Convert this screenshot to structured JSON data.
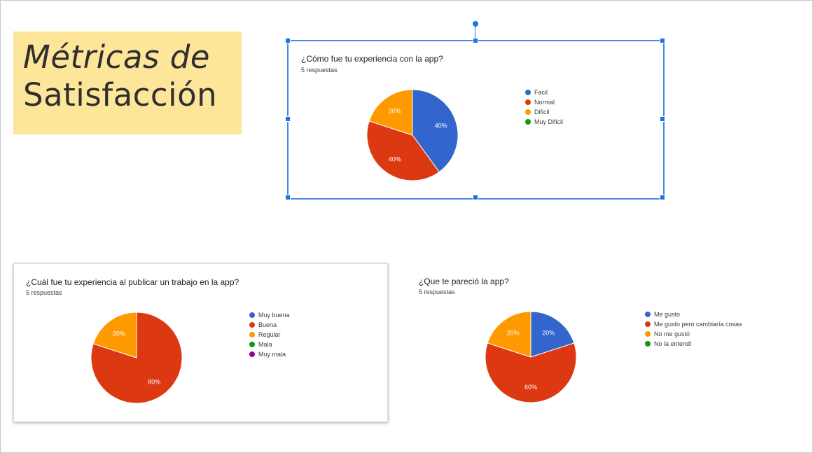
{
  "slide": {
    "title_line1": "Métricas de",
    "title_line2": "Satisfacción"
  },
  "colors": {
    "blue": "#3366cc",
    "red": "#dc3912",
    "orange": "#ff9900",
    "green": "#109618",
    "purple": "#990099",
    "title_bg": "#fde59a",
    "selection": "#1a73e8"
  },
  "chart_data": [
    {
      "type": "pie",
      "title": "¿Cómo fue tu experiencia con la app?",
      "subtitle": "5 respuestas",
      "labels": [
        "Facil",
        "Normal",
        "Dificil",
        "Muy Dificil"
      ],
      "values": [
        40,
        40,
        20,
        0
      ],
      "colors": [
        "#3366cc",
        "#dc3912",
        "#ff9900",
        "#109618"
      ],
      "value_labels": [
        "40%",
        "40%",
        "20%",
        ""
      ],
      "legend": "right"
    },
    {
      "type": "pie",
      "title": "¿Cuál fue tu experiencia al publicar un trabajo en la app?",
      "subtitle": "5 respuestas",
      "labels": [
        "Muy buena",
        "Buena",
        "Regular",
        "Mala",
        "Muy mala"
      ],
      "values": [
        0,
        80,
        20,
        0,
        0
      ],
      "colors": [
        "#3366cc",
        "#dc3912",
        "#ff9900",
        "#109618",
        "#990099"
      ],
      "value_labels": [
        "",
        "80%",
        "20%",
        "",
        ""
      ],
      "legend": "right"
    },
    {
      "type": "pie",
      "title": "¿Que te pareció la app?",
      "subtitle": "5 respuestas",
      "labels": [
        "Me gusto",
        "Me gusto pero cambiaría cosas",
        "No me gustó",
        "No la entendí"
      ],
      "values": [
        20,
        60,
        20,
        0
      ],
      "colors": [
        "#3366cc",
        "#dc3912",
        "#ff9900",
        "#109618"
      ],
      "value_labels": [
        "20%",
        "60%",
        "20%",
        ""
      ],
      "legend": "right"
    }
  ]
}
